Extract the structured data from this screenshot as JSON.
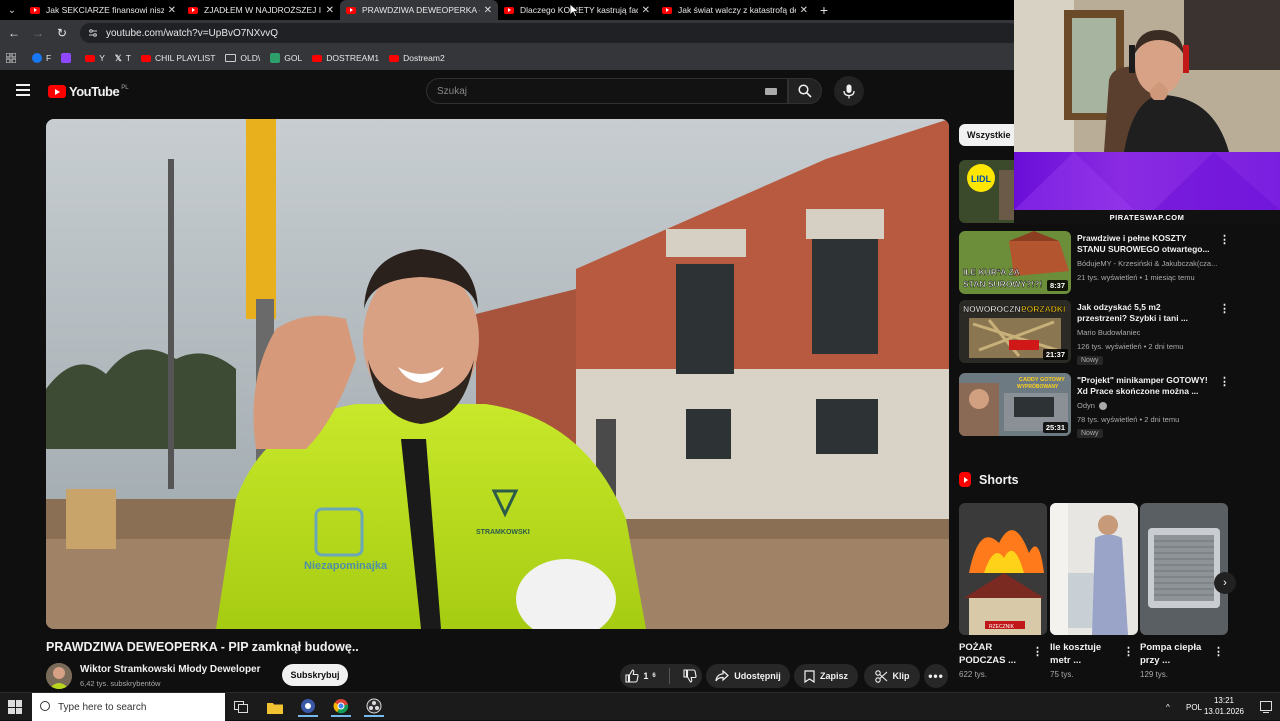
{
  "browser": {
    "tabs": [
      {
        "label": "Jak SEKCIARZE finansowi niszczą",
        "active": false
      },
      {
        "label": "ZJADŁEM W NAJDROŻSZEJ I NA",
        "active": false
      },
      {
        "label": "PRAWDZIWA DEWEOPERKA - P",
        "active": true
      },
      {
        "label": "Dlaczego KOBIETY kastrują face",
        "active": false
      },
      {
        "label": "Jak świat walczy z katastrofą de",
        "active": false
      }
    ],
    "url": "youtube.com/watch?v=UpBvO7NXvvQ",
    "bookmarks": [
      {
        "label": "F",
        "color": "#1877f2"
      },
      {
        "label": "",
        "color": "#9146ff"
      },
      {
        "label": "Y",
        "color": "#ff0000"
      },
      {
        "label": "T",
        "color": "#e8e8e8"
      },
      {
        "label": "CHIL PLAYLIST",
        "color": "#ff0000"
      },
      {
        "label": "OLD\\",
        "color": "#888888"
      },
      {
        "label": "GOL",
        "color": "#2e9e6b"
      },
      {
        "label": "DOSTREAM1",
        "color": "#ff0000"
      },
      {
        "label": "Dostream2",
        "color": "#ff0000"
      }
    ]
  },
  "youtube": {
    "logo_text": "YouTube",
    "country_code": "PL",
    "search_placeholder": "Szukaj"
  },
  "video": {
    "title": "PRAWDZIWA DEWEOPERKA - PIP zamknął budowę..",
    "channel": "Wiktor Stramkowski  Młody Deweloper",
    "subscribers": "6,42 tys. subskrybentów",
    "subscribe_label": "Subskrybuj",
    "likes": "1",
    "likes_sup": "6",
    "share_label": "Udostępnij",
    "save_label": "Zapisz",
    "clip_label": "Klip"
  },
  "sidebar": {
    "chip_all": "Wszystkie",
    "recommendations": [
      {
        "title": "Prawdziwe i pełne KOSZTY STANU SUROWEGO otwartego...",
        "channel": "BódujeMY - Krzesiński & Jakubczak(cza...",
        "meta": "21 tys. wyświetleń • 1 miesiąc temu",
        "duration": "8:37",
        "badge": "",
        "thumb_text": "ILE KUR*A ZA STAN SUROWY?!?!"
      },
      {
        "title": "Jak odzyskać 5,5 m2 przestrzeni? Szybki i tani ...",
        "channel": "Mario Budowlaniec",
        "meta": "126 tys. wyświetleń • 2 dni temu",
        "duration": "21:37",
        "badge": "Nowy",
        "thumb_text": "NOWOROCZNE PORZĄDKI"
      },
      {
        "title": "\"Projekt\" minikamper GOTOWY! Xd Prace skończone można ...",
        "channel": "Odyn",
        "meta": "78 tys. wyświetleń • 2 dni temu",
        "duration": "25:31",
        "badge": "Nowy",
        "thumb_text": "CADDY GOTOWY WYPRÓBOWANY"
      }
    ],
    "shorts_title": "Shorts",
    "shorts": [
      {
        "title": "POŻAR PODCZAS ...",
        "views": "622 tys.",
        "thumb_text": "RZECZNIK"
      },
      {
        "title": "Ile kosztuje metr ...",
        "views": "75 tys."
      },
      {
        "title": "Pompa ciepła przy ...",
        "views": "129 tys."
      }
    ]
  },
  "overlay": {
    "sponsor_text": "PIRATESWAP.COM"
  },
  "taskbar": {
    "search_placeholder": "Type here to search",
    "language": "POL",
    "time": "13:21",
    "date": "13.01.2026"
  },
  "colors": {
    "youtube_red": "#ff0000",
    "background": "#0f0f0f",
    "pirate_purple": "#8a2be2"
  }
}
